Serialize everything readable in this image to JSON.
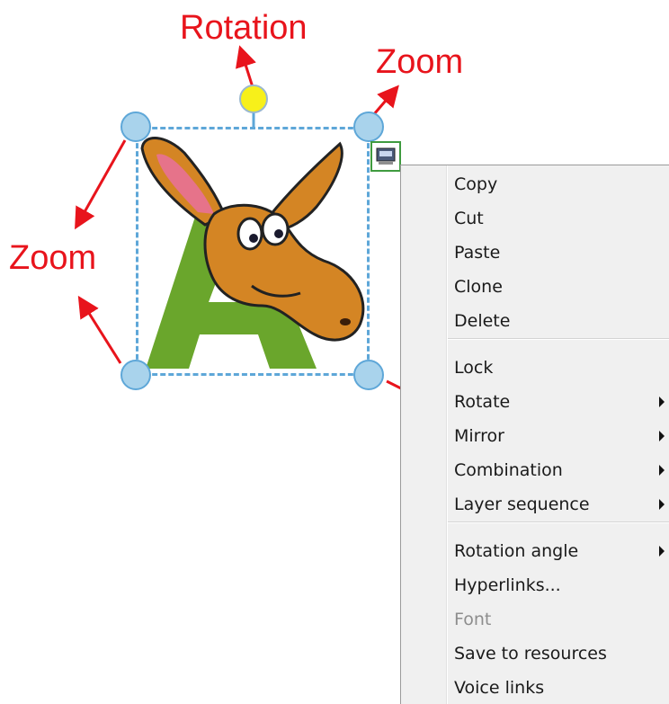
{
  "annotations": {
    "rotation_label": "Rotation",
    "zoom_top_right_label": "Zoom",
    "zoom_left_label": "Zoom"
  },
  "colors": {
    "annotation_red": "#e8141c",
    "handle_fill": "#a9d3ec",
    "handle_stroke": "#5ea7d8",
    "rotation_handle_fill": "#f7f01a",
    "lock_button_border": "#3f9b3f",
    "menu_background": "#f0f0f0"
  },
  "selected_object": {
    "image": "cartoon-moose-letter-a",
    "letter": "A"
  },
  "context_menu": {
    "groups": [
      [
        {
          "label": "Copy"
        },
        {
          "label": "Cut"
        },
        {
          "label": "Paste"
        },
        {
          "label": "Clone"
        },
        {
          "label": "Delete"
        }
      ],
      [
        {
          "label": "Lock"
        },
        {
          "label": "Rotate",
          "submenu": true
        },
        {
          "label": "Mirror",
          "submenu": true
        },
        {
          "label": "Combination",
          "submenu": true
        },
        {
          "label": "Layer sequence",
          "submenu": true
        }
      ],
      [
        {
          "label": "Rotation angle",
          "submenu": true
        },
        {
          "label": "Hyperlinks..."
        },
        {
          "label": "Font",
          "disabled": true
        },
        {
          "label": "Save to resources"
        },
        {
          "label": "Voice links"
        }
      ]
    ]
  }
}
